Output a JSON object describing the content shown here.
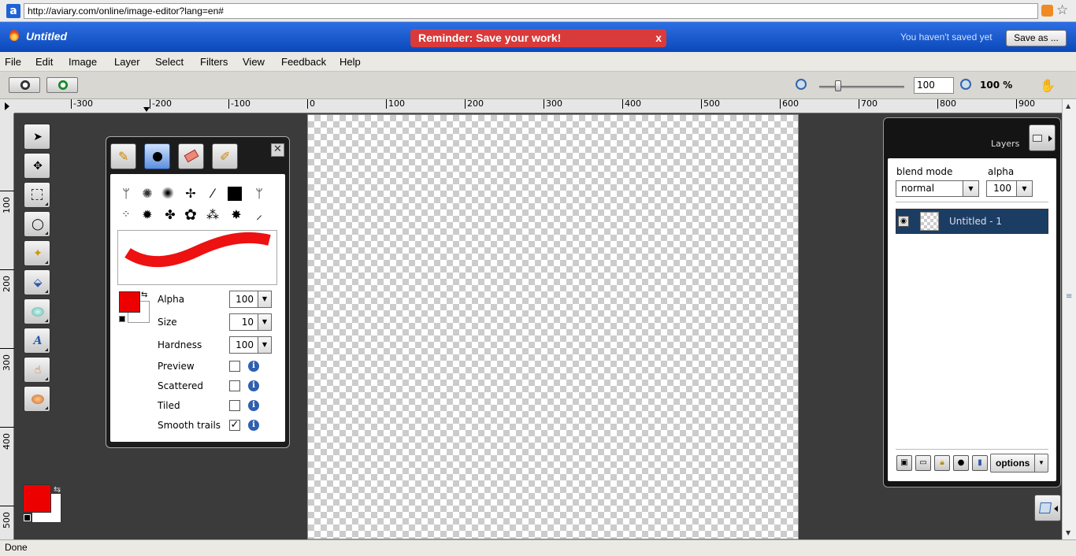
{
  "browser": {
    "url": "http://aviary.com/online/image-editor?lang=en#"
  },
  "app": {
    "title": "Untitled",
    "reminder": "Reminder: Save your work!",
    "reminder_close": "x",
    "save_status": "You haven't saved yet",
    "save_as_label": "Save as ..."
  },
  "menu": [
    "File",
    "Edit",
    "Image",
    "Layer",
    "Select",
    "Filters",
    "View",
    "Feedback",
    "Help"
  ],
  "zoom": {
    "value": "100",
    "percent": "100 %"
  },
  "ruler": {
    "h": [
      "-300",
      "-200",
      "-100",
      "0",
      "100",
      "200",
      "300",
      "400",
      "500",
      "600",
      "700",
      "800",
      "900"
    ],
    "v": [
      "100",
      "200",
      "300",
      "400",
      "500"
    ]
  },
  "tools": [
    "pointer-icon",
    "move-icon",
    "marquee-icon",
    "lasso-icon",
    "magic-wand-icon",
    "fill-bucket-icon",
    "shape-icon",
    "text-icon",
    "smudge-icon",
    "color-picker-icon"
  ],
  "colors": {
    "primary": "#ed0000",
    "secondary": "#ffffff",
    "accent": "#1c3d63"
  },
  "brush_panel": {
    "tabs": [
      "brush-icon",
      "paint-brush-icon",
      "eraser-icon",
      "smudge-brush-icon"
    ],
    "alpha_label": "Alpha",
    "alpha": "100",
    "size_label": "Size",
    "size": "10",
    "hardness_label": "Hardness",
    "hardness": "100",
    "options": [
      {
        "label": "Preview",
        "checked": false
      },
      {
        "label": "Scattered",
        "checked": false
      },
      {
        "label": "Tiled",
        "checked": false
      },
      {
        "label": "Smooth trails",
        "checked": true
      }
    ]
  },
  "layers_panel": {
    "title": "Layers",
    "blend_mode_label": "blend mode",
    "blend_mode": "normal",
    "alpha_label": "alpha",
    "alpha": "100",
    "layers": [
      {
        "name": "Untitled - 1"
      }
    ],
    "options_label": "options"
  },
  "status": "Done"
}
